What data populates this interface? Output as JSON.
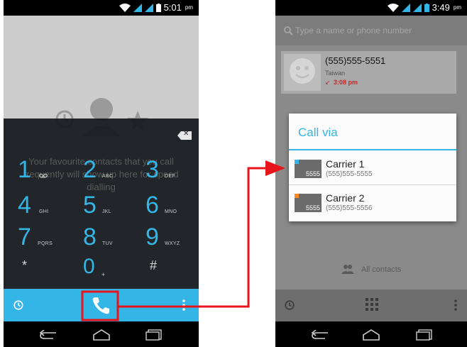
{
  "left_phone": {
    "status": {
      "time": "5:01",
      "ampm": "pm"
    },
    "empty_text": "Your favourite contacts that you call frequently will show up here for speed dialling",
    "keypad": [
      {
        "digit": "1",
        "letters": ""
      },
      {
        "digit": "2",
        "letters": "ABC"
      },
      {
        "digit": "3",
        "letters": "DEF"
      },
      {
        "digit": "4",
        "letters": "GHI"
      },
      {
        "digit": "5",
        "letters": "JKL"
      },
      {
        "digit": "6",
        "letters": "MNO"
      },
      {
        "digit": "7",
        "letters": "PQRS"
      },
      {
        "digit": "8",
        "letters": "TUV"
      },
      {
        "digit": "9",
        "letters": "WXYZ"
      },
      {
        "digit": "*",
        "letters": ""
      },
      {
        "digit": "0",
        "letters": "+"
      },
      {
        "digit": "#",
        "letters": ""
      }
    ],
    "icons": {
      "recent": "clock-icon",
      "call": "phone-icon",
      "overflow": "more-vertical-icon",
      "backspace": "backspace-icon",
      "voicemail": "voicemail-icon"
    }
  },
  "right_phone": {
    "status": {
      "time": "3:49",
      "ampm": "pm"
    },
    "search": {
      "placeholder": "Type a name or phone number"
    },
    "recent_contact": {
      "number": "(555)555-5551",
      "location": "Taiwan",
      "time": "3:08 pm"
    },
    "dialog": {
      "title": "Call via",
      "options": [
        {
          "name": "Carrier 1",
          "number": "(555)555-5555",
          "sim_label": "5555",
          "color": "#33b5e5"
        },
        {
          "name": "Carrier 2",
          "number": "(555)555-5556",
          "sim_label": "5555",
          "color": "#ff8a1a"
        }
      ]
    },
    "all_contacts_label": "All contacts"
  },
  "colors": {
    "accent": "#33b5e5",
    "highlight": "#e8141b",
    "missed_call": "#c62828"
  }
}
